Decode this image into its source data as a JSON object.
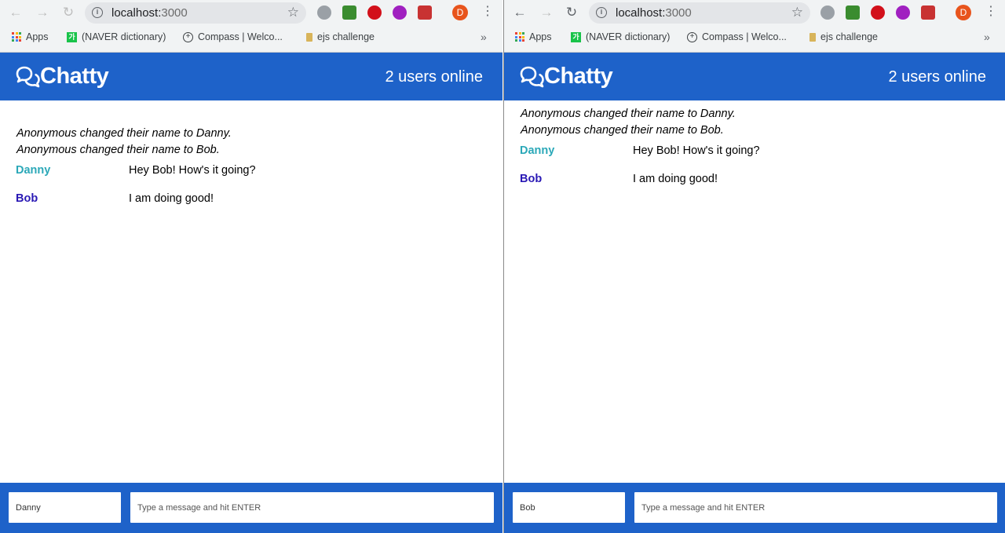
{
  "windows": [
    {
      "id": "left",
      "browser": {
        "url_host": "localhost:",
        "url_port": "3000",
        "bookmarks": [
          {
            "icon": "apps-grid-icon",
            "label": "Apps"
          },
          {
            "icon": "naver-icon",
            "label": "(NAVER dictionary)"
          },
          {
            "icon": "compass-icon",
            "label": "Compass | Welco..."
          },
          {
            "icon": "ejs-icon",
            "label": "ejs challenge"
          }
        ],
        "more_label": "»",
        "avatar_letter": "D"
      },
      "app": {
        "brand": "Chatty",
        "users_online": "2 users online",
        "notifications": [
          "Anonymous changed their name to Danny.",
          "Anonymous changed their name to Bob."
        ],
        "messages": [
          {
            "user": "Danny",
            "color": "#2ba8b8",
            "text": "Hey Bob! How's it going?"
          },
          {
            "user": "Bob",
            "color": "#2a19b5",
            "text": "I am doing good!"
          }
        ],
        "username_value": "Danny",
        "message_placeholder": "Type a message and hit ENTER"
      }
    },
    {
      "id": "right",
      "browser": {
        "url_host": "localhost:",
        "url_port": "3000",
        "bookmarks": [
          {
            "icon": "apps-grid-icon",
            "label": "Apps"
          },
          {
            "icon": "naver-icon",
            "label": "(NAVER dictionary)"
          },
          {
            "icon": "compass-icon",
            "label": "Compass | Welco..."
          },
          {
            "icon": "ejs-icon",
            "label": "ejs challenge"
          }
        ],
        "more_label": "»",
        "avatar_letter": "D"
      },
      "app": {
        "brand": "Chatty",
        "users_online": "2 users online",
        "notifications": [
          "Anonymous changed their name to Danny.",
          "Anonymous changed their name to Bob."
        ],
        "messages": [
          {
            "user": "Danny",
            "color": "#2ba8b8",
            "text": "Hey Bob! How's it going?"
          },
          {
            "user": "Bob",
            "color": "#2a19b5",
            "text": "I am doing good!"
          }
        ],
        "username_value": "Bob",
        "message_placeholder": "Type a message and hit ENTER"
      }
    }
  ],
  "colors": {
    "brand_blue": "#1e62c9",
    "chrome_bg": "#f1f3f4"
  }
}
